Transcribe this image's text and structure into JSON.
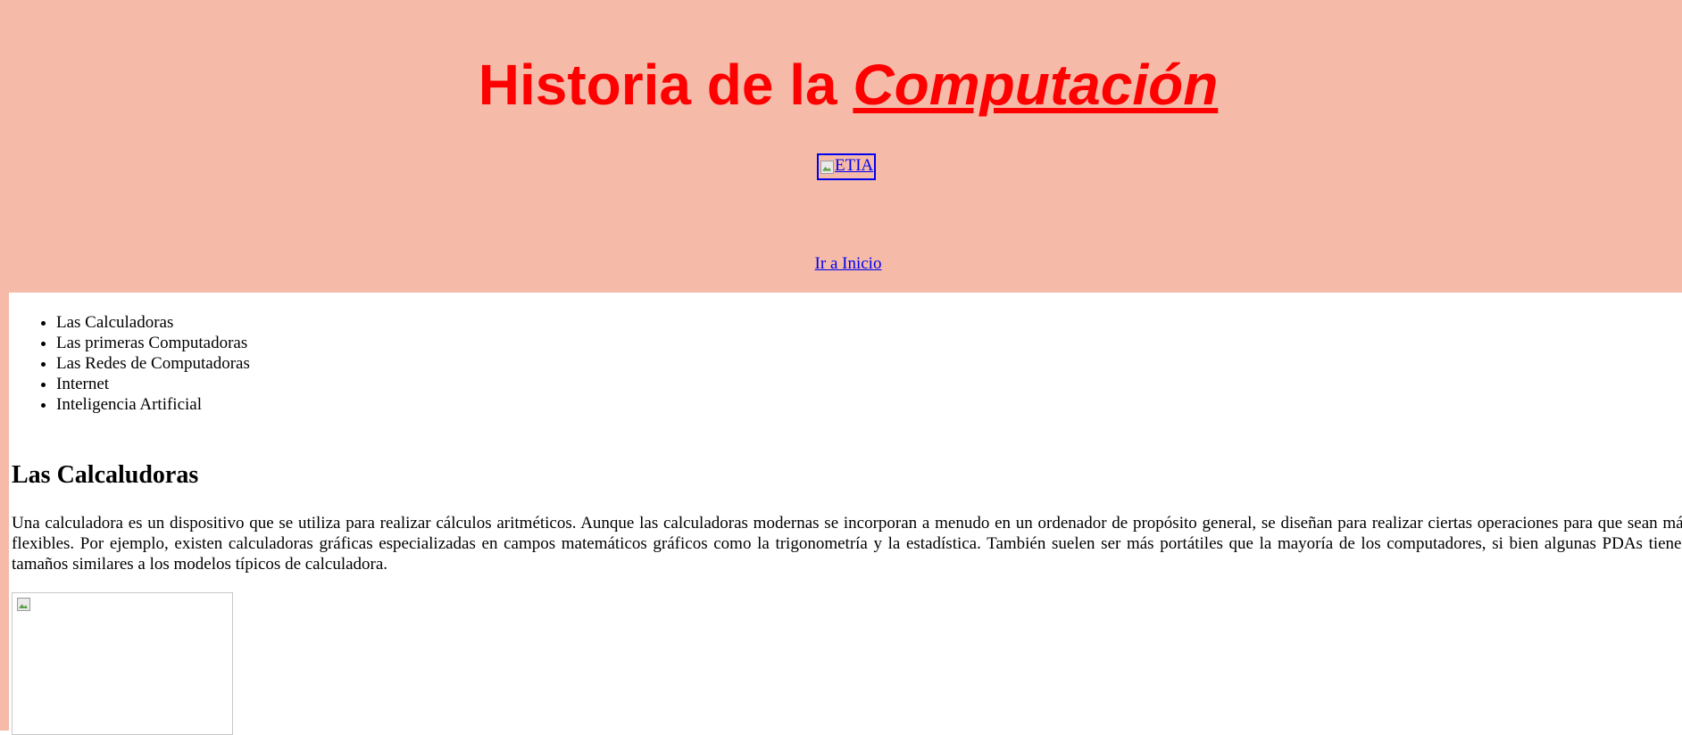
{
  "header": {
    "title_part1": "Historia",
    "title_part2": " de la ",
    "title_part3": "Computación",
    "logo_alt": "ETIA",
    "home_link": "Ir a Inicio"
  },
  "nav": {
    "items": [
      {
        "label": "Las Calculadoras"
      },
      {
        "label": "Las primeras Computadoras"
      },
      {
        "label": "Las Redes de Computadoras"
      },
      {
        "label": "Internet"
      },
      {
        "label": "Inteligencia Artificial"
      }
    ]
  },
  "section": {
    "heading": "Las Calcaludoras",
    "paragraph": "Una calculadora es un dispositivo que se utiliza para realizar cálculos aritméticos. Aunque las calculadoras modernas se incorporan a menudo en un ordenador de propósito general, se diseñan para realizar ciertas operaciones para que sean más flexibles. Por ejemplo, existen calculadoras gráficas especializadas en campos matemáticos gráficos como la trigonometría y la estadística. También suelen ser más portátiles que la mayoría de los computadores, si bien algunas PDAs tienen tamaños similares a los modelos típicos de calculadora."
  },
  "colors": {
    "header_background": "#f5baa8",
    "title_color": "#ff0000",
    "link_color": "#0000ee"
  },
  "icons": {
    "logo": "broken-image-icon",
    "section_image": "broken-image-icon"
  }
}
